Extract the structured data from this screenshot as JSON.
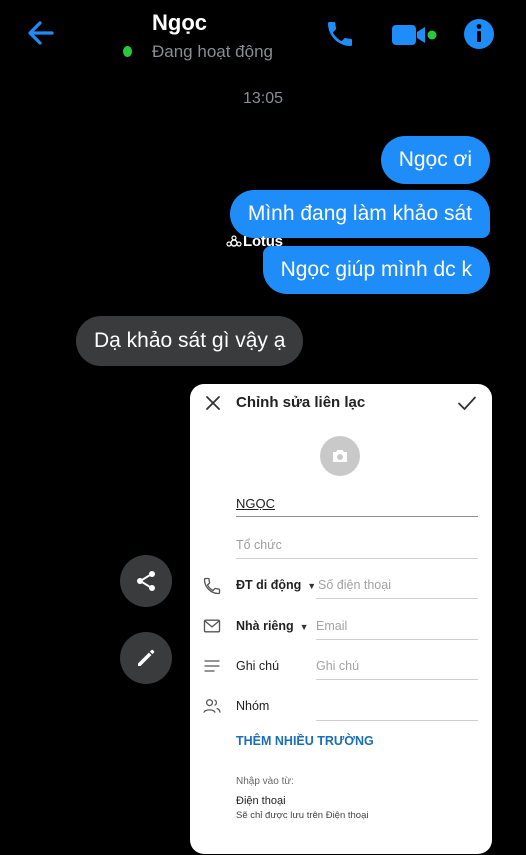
{
  "header": {
    "contact_name": "Ngọc",
    "status": "Đang hoạt động",
    "back_icon": "arrow-left-icon",
    "actions": [
      "phone-icon",
      "video-camera-icon",
      "info-icon"
    ],
    "accent_color": "#1e8dfa",
    "online_color": "#27c93f"
  },
  "chat": {
    "timestamp": "13:05",
    "messages": [
      {
        "side": "sent",
        "text": "Ngọc ơi"
      },
      {
        "side": "sent",
        "text": "Mình đang làm khảo sát"
      },
      {
        "side": "sent",
        "text": "Ngọc giúp mình dc k"
      },
      {
        "side": "received",
        "text": "Dạ khảo sát gì vậy ạ"
      }
    ],
    "watermark": "Lotus"
  },
  "side_actions": [
    "share-icon",
    "pencil-icon"
  ],
  "contact_editor": {
    "title": "Chỉnh sửa liên lạc",
    "name_value": "NGỌC",
    "organization_placeholder": "Tổ chức",
    "phone": {
      "label": "ĐT di động",
      "placeholder": "Số điện thoại"
    },
    "email": {
      "label": "Nhà riêng",
      "placeholder": "Email"
    },
    "note": {
      "label": "Ghi chú",
      "placeholder": "Ghi chú"
    },
    "group": {
      "label": "Nhóm"
    },
    "more_fields": "THÊM NHIỀU TRƯỜNG",
    "import_from_label": "Nhập vào từ:",
    "import_from_value": "Điện thoại",
    "import_note": "Sẽ chỉ được lưu trên Điện thoại",
    "link_color": "#1a6fb5"
  }
}
